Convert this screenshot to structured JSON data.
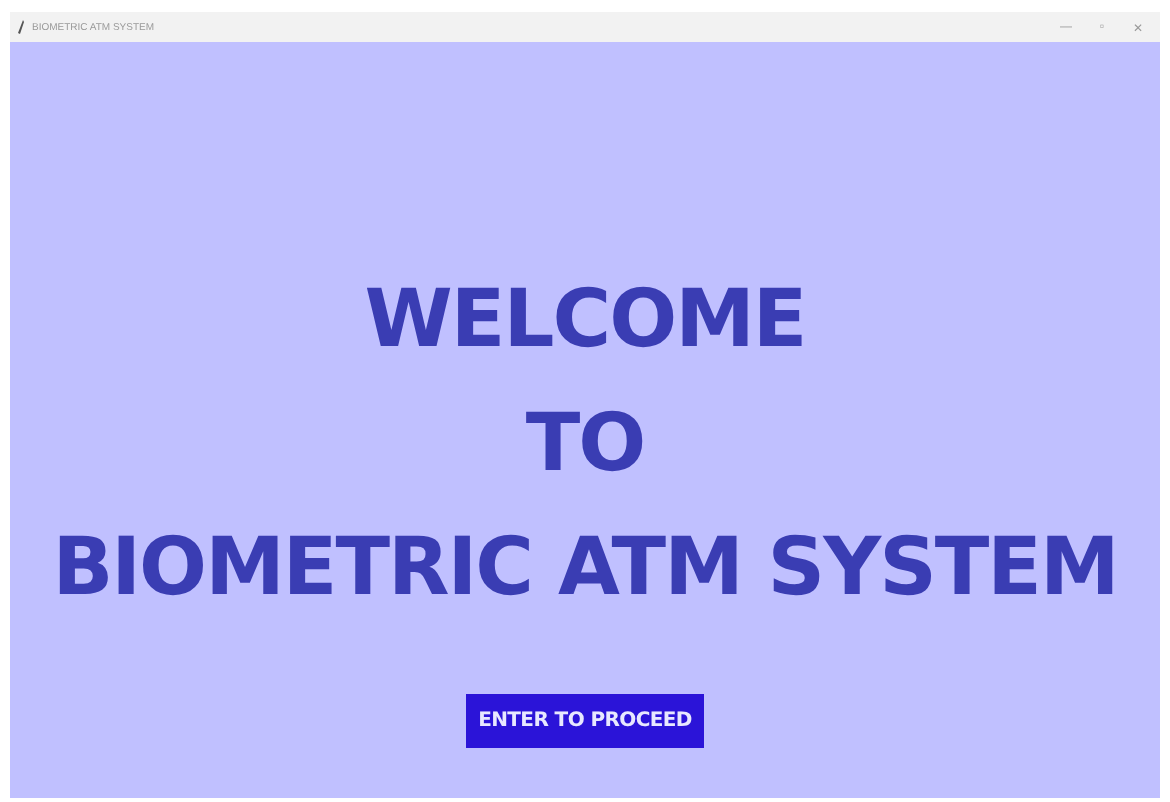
{
  "window": {
    "title": "BIOMETRIC ATM SYSTEM",
    "controls": [
      "—",
      "▫",
      "✕"
    ]
  },
  "heading": [
    "WELCOME",
    "TO",
    "BIOMETRIC ATM SYSTEM"
  ],
  "button": {
    "label": "ENTER TO PROCEED"
  }
}
